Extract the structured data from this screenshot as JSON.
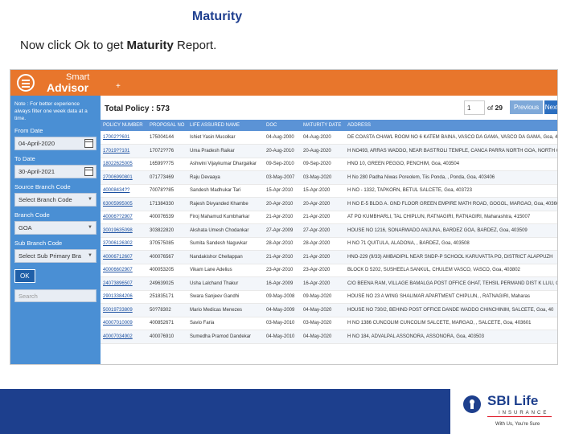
{
  "slide": {
    "title": "Maturity",
    "instruction_prefix": "Now click Ok to get ",
    "instruction_bold": "Maturity",
    "instruction_suffix": " Report."
  },
  "app": {
    "logo_line1": "Smart",
    "logo_line2": "Advisor",
    "logo_plus": "+",
    "accent_color": "#e8762c",
    "sidebar_color": "#4a8fd4"
  },
  "sidebar": {
    "note": "Note : For better experience always filter one week data at a time.",
    "from_date_label": "From Date",
    "from_date_value": "04-April-2020",
    "to_date_label": "To Date",
    "to_date_value": "30-April-2021",
    "source_branch_label": "Source Branch Code",
    "source_branch_value": "Select Branch Code",
    "branch_label": "Branch Code",
    "branch_value": "GOA",
    "sub_branch_label": "Sub Branch Code",
    "sub_branch_value": "Select Sub Primary Bra",
    "ok_label": "OK",
    "search_placeholder": "Search"
  },
  "pager": {
    "total_label": "Total Policy : 573",
    "current_page": "1",
    "of_text": "of",
    "total_pages": "29",
    "previous_label": "Previous",
    "next_label": "Next"
  },
  "table": {
    "columns": [
      "POLICY NUMBER",
      "PROPOSAL NO",
      "LIFE ASSURED NAME",
      "DOC",
      "MATURITY DATE",
      "ADDRESS"
    ],
    "rows": [
      [
        "17002??601",
        "175004144",
        "Ishiet Yasin Mucolkar",
        "04-Aug-2000",
        "04-Aug-2020",
        "DE COASTA CHAWL ROOM NO 6 KATEM BAINA, VASCO DA GAMA, VASCO DA GAMA, Goa, 403802"
      ],
      [
        "17019??101",
        "17072??76",
        "Uma Pradesh Raikar",
        "20-Aug-2010",
        "20-Aug-2020",
        "H NO493, ARRAS WADDO, NEAR BASTROLI TEMPLE, CANCA PARRA NORTH GOA, NORTH GOA"
      ],
      [
        "18022625005",
        "16599??75",
        "Ashwini Vijaykumar Dhargalkar",
        "09-Sep-2010",
        "09-Sep-2020",
        "HNO 10, GREEN PEGGO, PENCHIM, Goa, 403504"
      ],
      [
        "27006990801",
        "071773469",
        "Raju Devaaya",
        "03-May-2007",
        "03-May-2020",
        "H No 280 Padha Niwas Poreolem, Tiis Ponda, , Ponda, Goa, 403406"
      ],
      [
        "40008434??",
        "70078??85",
        "Sandesh Madhukar Tari",
        "15-Apr-2010",
        "15-Apr-2020",
        "H NO - 1332, TAPKORN, BETUL SALCETE, Goa, 403723"
      ],
      [
        "63005995005",
        "171384330",
        "Rajesh Divyanded Khambe",
        "20-Apr-2010",
        "20-Apr-2020",
        "H NO E-5 BLDG A. GND FLOOR GREEN EMPIRE MATH ROAD, GOGOL, MARGAO, Goa, 40360"
      ],
      [
        "40006??2907",
        "400076539",
        "Firoj Mahamud Kumbharkar",
        "21-Apr-2010",
        "21-Apr-2020",
        "AT PO KUMBHARLI, TAL CHIPLUN, RATNAGIRI, RATNAGIRI, Maharashtra, 415007"
      ],
      [
        "30019635098",
        "303822820",
        "Akshata Umesh Chodankar",
        "27-Apr-2009",
        "27-Apr-2020",
        "HOUSE NO 1216, SONARWADO ANJUNA, BARDEZ GOA, BARDEZ, Goa, 403509"
      ],
      [
        "37006126302",
        "370575085",
        "Sumita Sandesh Naguvkar",
        "28-Apr-2010",
        "28-Apr-2020",
        "H NO 71 QUITULA, ALADONA, , BARDEZ, Goa, 403508"
      ],
      [
        "40006712607",
        "400076567",
        "Nandakishor Chellappan",
        "21-Apr-2010",
        "21-Apr-2020",
        "HNO-229 (9/33) AMBADIPIL NEAR SNDP-P SCHOOL KARUVATTA PO, DISTRICT ALAPPUZH"
      ],
      [
        "40006602907",
        "400053205",
        "Vikam Lane Adelius",
        "23-Apr-2010",
        "23-Apr-2020",
        "BLOCK D 5202, SUSHEELA SANKUL, CHULEM VASCO, VASCO, Goa, 403802"
      ],
      [
        "24073896507",
        "249639025",
        "Usha Lalchand Thakur",
        "16-Apr-2009",
        "16-Apr-2020",
        "C/O BEENA RAM, VILLAGE BAMALGA POST OFFICE GHAT, TEHSIL PERMAND DIST K LLIU, C"
      ],
      [
        "29013384206",
        "251835171",
        "Swara Sanjeev Gandhi",
        "09-May-2008",
        "09-May-2020",
        "HOUSE NO 23 A WING SHALIMAR APARTMENT CHIPLUN, , RATNAGIRI, Maharas"
      ],
      [
        "50019733809",
        "50?78302",
        "Mario Medicas Menezes",
        "04-May-2009",
        "04-May-2020",
        "HOUSE NO 730/2, BEHIND POST OFFICE DANDE WADDO CHINCHINIM, SALCETE, Goa, 40"
      ],
      [
        "40007010009",
        "400852671",
        "Savio Faria",
        "03-May-2010",
        "03-May-2020",
        "H NO 1386 CUNCOLIM CUNCOLIM SALCETE, MARGAO, , SALCETE, Goa, 403601"
      ],
      [
        "40007034902",
        "400076910",
        "Sumedha Pramod Dandekar",
        "04-May-2010",
        "04-May-2020",
        "H NO 184, ADVALPAL ASSONORA, ASSONORA, Goa, 403503"
      ]
    ]
  },
  "footer": {
    "brand_name": "SBI Life",
    "brand_sub": "INSURANCE",
    "brand_tagline": "With Us, You're Sure",
    "bar_color": "#1d3f8d"
  }
}
